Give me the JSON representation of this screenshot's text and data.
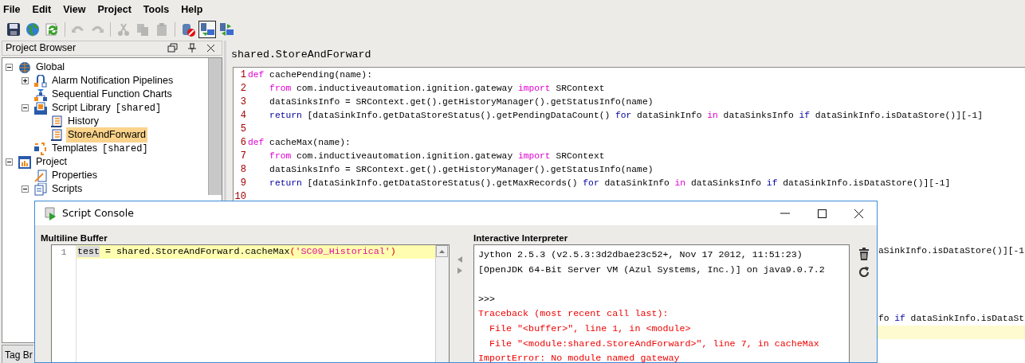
{
  "menu": [
    "File",
    "Edit",
    "View",
    "Project",
    "Tools",
    "Help"
  ],
  "toolbar": [
    [
      {
        "kind": "save",
        "disabled": false,
        "pressed": false
      },
      {
        "kind": "globe",
        "disabled": false,
        "pressed": false
      },
      {
        "kind": "refresh",
        "disabled": false,
        "pressed": false
      }
    ],
    [
      {
        "kind": "undo",
        "disabled": true,
        "pressed": false
      },
      {
        "kind": "redo",
        "disabled": true,
        "pressed": false
      }
    ],
    [
      {
        "kind": "cut",
        "disabled": true,
        "pressed": false
      },
      {
        "kind": "copy",
        "disabled": true,
        "pressed": false
      },
      {
        "kind": "paste",
        "disabled": true,
        "pressed": false
      }
    ],
    [
      {
        "kind": "db-stop",
        "disabled": false,
        "pressed": false
      },
      {
        "kind": "comm-read",
        "disabled": false,
        "pressed": true
      },
      {
        "kind": "comm-readwrite",
        "disabled": false,
        "pressed": false
      }
    ]
  ],
  "project_browser": {
    "title": "Project Browser",
    "tree": [
      {
        "kind": "globe",
        "label": "Global",
        "expanded": true,
        "selected": false,
        "children": [
          {
            "kind": "pipeline",
            "label": "Alarm Notification Pipelines",
            "expanded": false,
            "selected": false
          },
          {
            "kind": "sfc",
            "label": "Sequential Function Charts",
            "selected": false
          },
          {
            "kind": "library",
            "label": "Script Library",
            "tag": "[shared]",
            "expanded": true,
            "selected": false,
            "children": [
              {
                "kind": "script",
                "label": "History",
                "selected": false
              },
              {
                "kind": "script",
                "label": "StoreAndForward",
                "selected": true
              }
            ]
          },
          {
            "kind": "templates",
            "label": "Templates",
            "tag": "[shared]",
            "selected": false
          }
        ]
      },
      {
        "kind": "project",
        "label": "Project",
        "expanded": true,
        "selected": false,
        "children": [
          {
            "kind": "properties",
            "label": "Properties",
            "selected": false
          },
          {
            "kind": "scripts",
            "label": "Scripts",
            "expanded": true,
            "selected": false
          }
        ]
      }
    ],
    "bottom_tab": "Tag Br"
  },
  "editor": {
    "title": "shared.StoreAndForward",
    "lines": [
      {
        "number": "1",
        "current": false,
        "segments": [
          {
            "kind": "keyword",
            "text": "def"
          },
          {
            "kind": "plain",
            "text": " cachePending(name):"
          }
        ]
      },
      {
        "number": "2",
        "current": false,
        "segments": [
          {
            "kind": "keyword",
            "text": "    from"
          },
          {
            "kind": "plain",
            "text": " com.inductiveautomation.ignition.gateway "
          },
          {
            "kind": "keyword",
            "text": "import"
          },
          {
            "kind": "plain",
            "text": " SRContext"
          }
        ]
      },
      {
        "number": "3",
        "current": false,
        "segments": [
          {
            "kind": "plain",
            "text": "    dataSinksInfo = SRContext.get().getHistoryManager().getStatusInfo(name)"
          }
        ]
      },
      {
        "number": "4",
        "current": false,
        "segments": [
          {
            "kind": "flow",
            "text": "    return"
          },
          {
            "kind": "plain",
            "text": " [dataSinkInfo.getDataStoreStatus().getPendingDataCount() "
          },
          {
            "kind": "flow",
            "text": "for"
          },
          {
            "kind": "plain",
            "text": " dataSinkInfo "
          },
          {
            "kind": "keyword",
            "text": "in"
          },
          {
            "kind": "plain",
            "text": " dataSinksInfo "
          },
          {
            "kind": "flow",
            "text": "if"
          },
          {
            "kind": "plain",
            "text": " dataSinkInfo.isDataStore()][-1]"
          }
        ]
      },
      {
        "number": "5",
        "current": false
      },
      {
        "number": "6",
        "current": false,
        "segments": [
          {
            "kind": "keyword",
            "text": "def"
          },
          {
            "kind": "plain",
            "text": " cacheMax(name):"
          }
        ]
      },
      {
        "number": "7",
        "current": false,
        "segments": [
          {
            "kind": "keyword",
            "text": "    from"
          },
          {
            "kind": "plain",
            "text": " com.inductiveautomation.ignition.gateway "
          },
          {
            "kind": "keyword",
            "text": "import"
          },
          {
            "kind": "plain",
            "text": " SRContext"
          }
        ]
      },
      {
        "number": "8",
        "current": false,
        "segments": [
          {
            "kind": "plain",
            "text": "    dataSinksInfo = SRContext.get().getHistoryManager().getStatusInfo(name)"
          }
        ]
      },
      {
        "number": "9",
        "current": false,
        "segments": [
          {
            "kind": "flow",
            "text": "    return"
          },
          {
            "kind": "plain",
            "text": " [dataSinkInfo.getDataStoreStatus().getMaxRecords() "
          },
          {
            "kind": "flow",
            "text": "for"
          },
          {
            "kind": "plain",
            "text": " dataSinkInfo "
          },
          {
            "kind": "keyword",
            "text": "in"
          },
          {
            "kind": "plain",
            "text": " dataSinksInfo "
          },
          {
            "kind": "flow",
            "text": "if"
          },
          {
            "kind": "plain",
            "text": " dataSinkInfo.isDataStore()][-1]"
          }
        ]
      },
      {
        "number": "10",
        "current": false
      },
      {
        "current": false
      },
      {
        "current": false
      },
      {
        "current": false
      },
      {
        "current": false,
        "fragment": true,
        "segments": [
          {
            "kind": "plain",
            "text": "aSinkInfo.isDataStore()][-1"
          }
        ]
      },
      {
        "current": false
      },
      {
        "current": false
      },
      {
        "current": false
      },
      {
        "current": false
      },
      {
        "current": false,
        "fragment": true,
        "segments": [
          {
            "kind": "plain",
            "text": "fo "
          },
          {
            "kind": "flow",
            "text": "if"
          },
          {
            "kind": "plain",
            "text": " dataSinkInfo.isDataSt"
          }
        ]
      },
      {
        "current": true
      }
    ]
  },
  "script_console": {
    "title": "Script Console",
    "buffer": {
      "label": "Multiline Buffer",
      "lines": [
        {
          "number": "1",
          "current": true,
          "segments": [
            {
              "kind": "marked",
              "text": "test"
            },
            {
              "kind": "plain",
              "text": " = shared.StoreAndForward.cacheMax"
            },
            {
              "kind": "paren",
              "text": "("
            },
            {
              "kind": "string",
              "text": "'SC09_Historical'"
            },
            {
              "kind": "paren",
              "text": ")"
            }
          ]
        }
      ]
    },
    "interpreter": {
      "label": "Interactive Interpreter",
      "lines": [
        {
          "kind": "output",
          "text": "Jython 2.5.3 (v2.5.3:3d2dbae23c52+, Nov 17 2012, 11:51:23)"
        },
        {
          "kind": "output",
          "text": "[OpenJDK 64-Bit Server VM (Azul Systems, Inc.)] on java9.0.7.2"
        },
        {
          "kind": "blank"
        },
        {
          "kind": "output",
          "text": ">>>"
        },
        {
          "kind": "error",
          "text": "Traceback (most recent call last):"
        },
        {
          "kind": "error",
          "text": "  File \"<buffer>\", line 1, in <module>"
        },
        {
          "kind": "error",
          "text": "  File \"<module:shared.StoreAndForward>\", line 7, in cacheMax"
        },
        {
          "kind": "error",
          "text": "ImportError: No module named gateway"
        }
      ]
    }
  }
}
